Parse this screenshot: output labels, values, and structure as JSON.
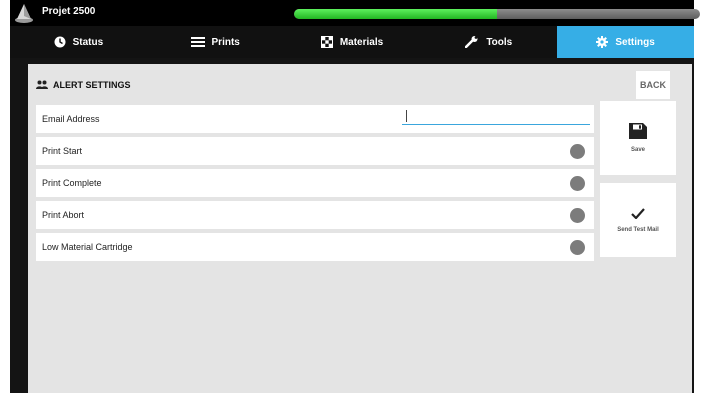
{
  "app": {
    "title": "Projet 2500",
    "progress": 0.5
  },
  "tabs": [
    {
      "label": "Status",
      "icon": "clock-icon",
      "active": false
    },
    {
      "label": "Prints",
      "icon": "list-icon",
      "active": false
    },
    {
      "label": "Materials",
      "icon": "checkerboard-icon",
      "active": false
    },
    {
      "label": "Tools",
      "icon": "wrench-icon",
      "active": false
    },
    {
      "label": "Settings",
      "icon": "gear-icon",
      "active": true
    }
  ],
  "panel": {
    "title": "ALERT SETTINGS",
    "back_label": "BACK",
    "fields": [
      {
        "label": "Email Address",
        "value": ""
      },
      {
        "label": "Print Start"
      },
      {
        "label": "Print Complete"
      },
      {
        "label": "Print Abort"
      },
      {
        "label": "Low Material Cartridge"
      }
    ],
    "save_label": "Save",
    "send_test_label": "Send Test Mail"
  },
  "colors": {
    "accent": "#36aee6",
    "progress": "#33cc33",
    "toggle_off": "#7c7c7c"
  }
}
